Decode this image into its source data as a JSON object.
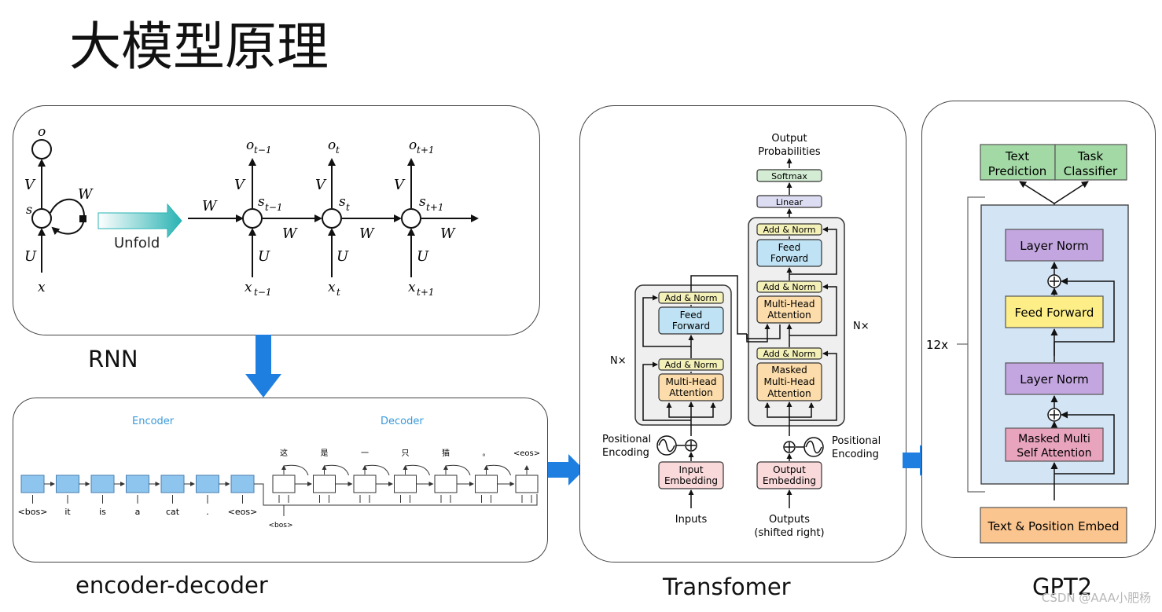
{
  "title": "大模型原理",
  "captions": {
    "rnn": "RNN",
    "encdec": "encoder-decoder",
    "transformer": "Transfomer",
    "gpt2": "GPT2"
  },
  "watermark": "CSDN @AAA小肥杨",
  "rnn": {
    "unfold": "Unfold",
    "o": "o",
    "s": "s",
    "x": "x",
    "V": "V",
    "U": "U",
    "W": "W",
    "steps": [
      {
        "o": "o",
        "o_sub": "t−1",
        "s": "s",
        "s_sub": "t−1",
        "x": "x",
        "x_sub": "t−1"
      },
      {
        "o": "o",
        "o_sub": "t",
        "s": "s",
        "s_sub": "t",
        "x": "x",
        "x_sub": "t"
      },
      {
        "o": "o",
        "o_sub": "t+1",
        "s": "s",
        "s_sub": "t+1",
        "x": "x",
        "x_sub": "t+1"
      }
    ]
  },
  "encdec": {
    "encoder_label": "Encoder",
    "decoder_label": "Decoder",
    "encoder_inputs": [
      "<bos>",
      "it",
      "is",
      "a",
      "cat",
      ".",
      "<eos>"
    ],
    "decoder_input": "<bos>",
    "decoder_outputs": [
      "这",
      "是",
      "一",
      "只",
      "猫",
      "。",
      "<eos>"
    ]
  },
  "transformer": {
    "output_probs_1": "Output",
    "output_probs_2": "Probabilities",
    "softmax": "Softmax",
    "linear": "Linear",
    "add_norm": "Add & Norm",
    "ff_1": "Feed",
    "ff_2": "Forward",
    "mha_1": "Multi-Head",
    "mha_2": "Attention",
    "masked_1": "Masked",
    "nx": "N×",
    "pos_enc_1": "Positional",
    "pos_enc_2": "Encoding",
    "input_emb_1": "Input",
    "input_emb_2": "Embedding",
    "output_emb_1": "Output",
    "output_emb_2": "Embedding",
    "inputs": "Inputs",
    "outputs_1": "Outputs",
    "outputs_2": "(shifted right)"
  },
  "gpt2": {
    "text_pred_1": "Text",
    "text_pred_2": "Prediction",
    "task_cls_1": "Task",
    "task_cls_2": "Classifier",
    "layer_norm": "Layer Norm",
    "feed_forward": "Feed Forward",
    "masked_1": "Masked Multi",
    "masked_2": "Self Attention",
    "embed": "Text & Position Embed",
    "repeat": "12x"
  },
  "colors": {
    "blue_arrow": "#1f7fe0",
    "teal_arrow": "#27b5b5",
    "enc_box": "#8ec5ee",
    "add_norm": "#f3f0b8",
    "ff": "#bfe3f5",
    "mha": "#fbdcaa",
    "softmax": "#d4ecd4",
    "linear": "#dcdcf2",
    "emb": "#f9d9da",
    "gpt_head": "#a3d9a5",
    "gpt_block": "#d3e4f5",
    "gpt_norm": "#c3a6e0",
    "gpt_ff": "#fdee87",
    "gpt_attn": "#e8a4bd",
    "gpt_embed": "#fbc590"
  }
}
